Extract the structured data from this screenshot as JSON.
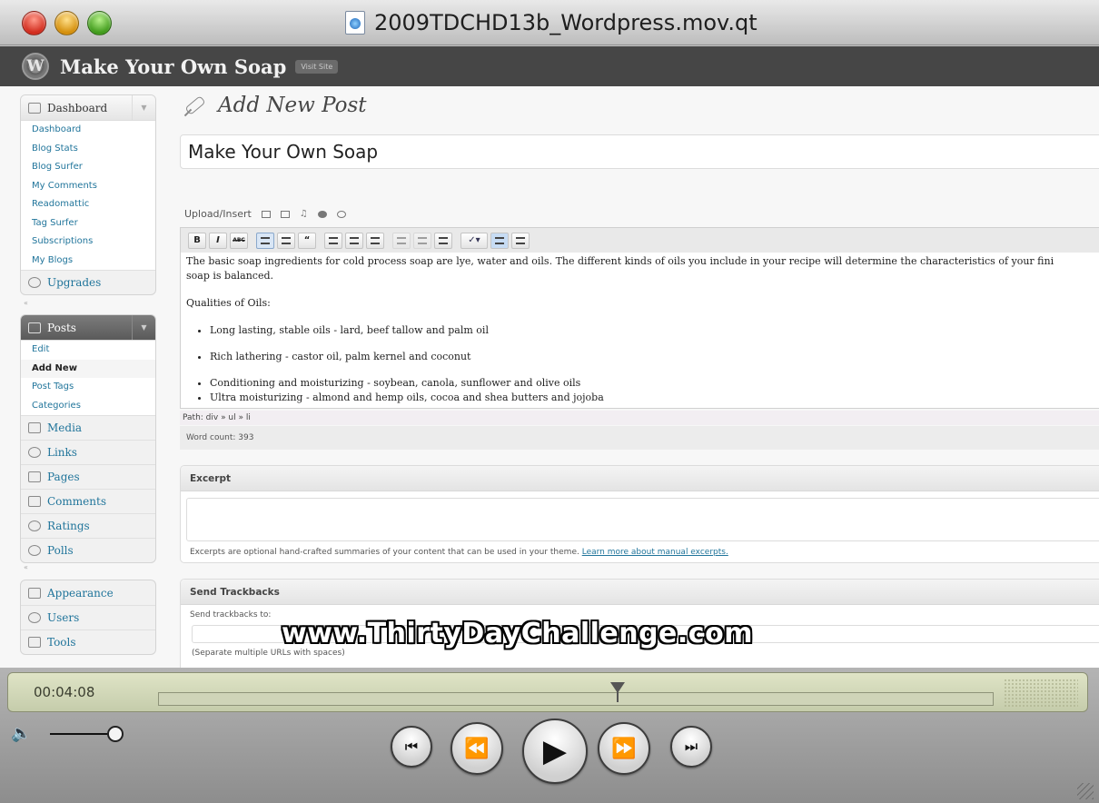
{
  "window": {
    "title": "2009TDCHD13b_Wordpress.mov.qt"
  },
  "wp": {
    "site_title": "Make Your Own Soap",
    "visit_site": "Visit Site"
  },
  "sidebar": {
    "dashboard": {
      "label": "Dashboard",
      "items": [
        "Dashboard",
        "Blog Stats",
        "Blog Surfer",
        "My Comments",
        "Readomattic",
        "Tag Surfer",
        "Subscriptions",
        "My Blogs"
      ]
    },
    "upgrades": "Upgrades",
    "posts": {
      "label": "Posts",
      "items": [
        "Edit",
        "Add New",
        "Post Tags",
        "Categories"
      ],
      "current": "Add New"
    },
    "menu": [
      "Media",
      "Links",
      "Pages",
      "Comments",
      "Ratings",
      "Polls"
    ],
    "menu2": [
      "Appearance",
      "Users",
      "Tools"
    ]
  },
  "page": {
    "title": "Add New Post",
    "post_title": "Make Your Own Soap",
    "upload_label": "Upload/Insert"
  },
  "editor": {
    "toolbar": {
      "bold": "B",
      "italic": "I",
      "strike": "ABC",
      "quote": "“"
    },
    "paragraph1": "The basic soap ingredients for cold process soap are lye, water and oils.  The different kinds of oils you include in your recipe will determine the characteristics of your fini",
    "paragraph1b": "soap is balanced.",
    "heading": "Qualities of Oils:",
    "list": [
      "Long lasting, stable oils - lard, beef tallow and palm oil",
      "Rich lathering - castor oil, palm kernel and coconut",
      "Conditioning and moisturizing - soybean, canola, sunflower and olive oils",
      "Ultra moisturizing - almond and hemp oils, cocoa and shea butters and jojoba"
    ],
    "path": "Path: div » ul » li",
    "word_count": "Word count: 393"
  },
  "excerpt": {
    "title": "Excerpt",
    "note": "Excerpts are optional hand-crafted summaries of your content that can be used in your theme.",
    "link": "Learn more about manual excerpts."
  },
  "trackbacks": {
    "title": "Send Trackbacks",
    "label": "Send trackbacks to:",
    "note": "(Separate multiple URLs with spaces)"
  },
  "watermark": "www.ThirtyDayChallenge.com",
  "player": {
    "time": "00:04:08",
    "progress": 0.55,
    "volume": 0.9
  }
}
